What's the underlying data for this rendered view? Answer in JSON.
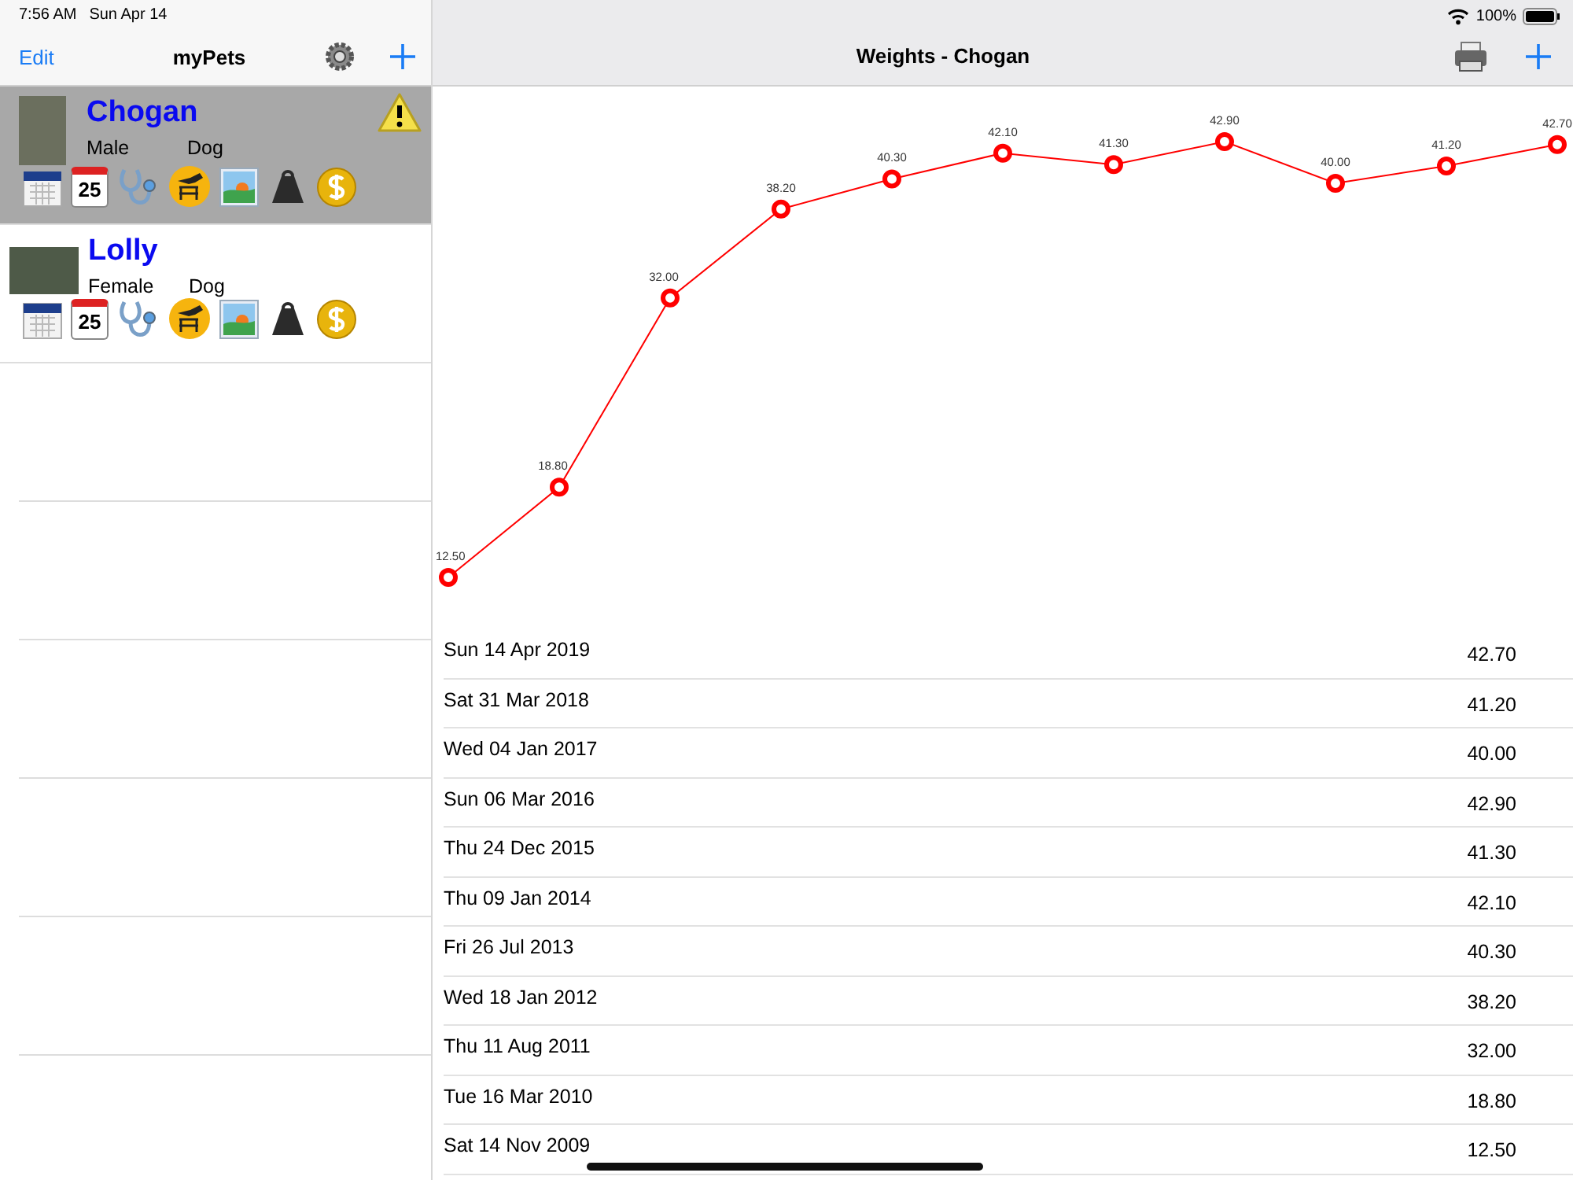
{
  "status_bar": {
    "time": "7:56 AM",
    "date": "Sun Apr 14",
    "battery": "100%"
  },
  "sidebar": {
    "edit": "Edit",
    "title": "myPets",
    "pets": [
      {
        "name": "Chogan",
        "sex": "Male",
        "species": "Dog",
        "selected": true,
        "warning": true,
        "calendar_day": "25"
      },
      {
        "name": "Lolly",
        "sex": "Female",
        "species": "Dog",
        "selected": false,
        "warning": false,
        "calendar_day": "25"
      }
    ]
  },
  "detail": {
    "title": "Weights - Chogan",
    "chart_data": {
      "type": "line",
      "series": [
        {
          "color": "#ff0000",
          "marker": "circle",
          "values": [
            12.5,
            18.8,
            32.0,
            38.2,
            40.3,
            42.1,
            41.3,
            42.9,
            40.0,
            41.2,
            42.7
          ],
          "value_labels": [
            "12.50",
            "18.80",
            "32.00",
            "38.20",
            "40.30",
            "42.10",
            "41.30",
            "42.90",
            "40.00",
            "41.20",
            "42.70"
          ]
        }
      ],
      "data_labels": true
    },
    "entries": [
      {
        "date": "Sun 14 Apr 2019",
        "weight": "42.70"
      },
      {
        "date": "Sat 31 Mar 2018",
        "weight": "41.20"
      },
      {
        "date": "Wed 04 Jan 2017",
        "weight": "40.00"
      },
      {
        "date": "Sun 06 Mar 2016",
        "weight": "42.90"
      },
      {
        "date": "Thu 24 Dec 2015",
        "weight": "41.30"
      },
      {
        "date": "Thu 09 Jan 2014",
        "weight": "42.10"
      },
      {
        "date": "Fri 26 Jul 2013",
        "weight": "40.30"
      },
      {
        "date": "Wed 18 Jan 2012",
        "weight": "38.20"
      },
      {
        "date": "Thu 11 Aug 2011",
        "weight": "32.00"
      },
      {
        "date": "Tue 16 Mar 2010",
        "weight": "18.80"
      },
      {
        "date": "Sat 14 Nov 2009",
        "weight": "12.50"
      }
    ]
  }
}
